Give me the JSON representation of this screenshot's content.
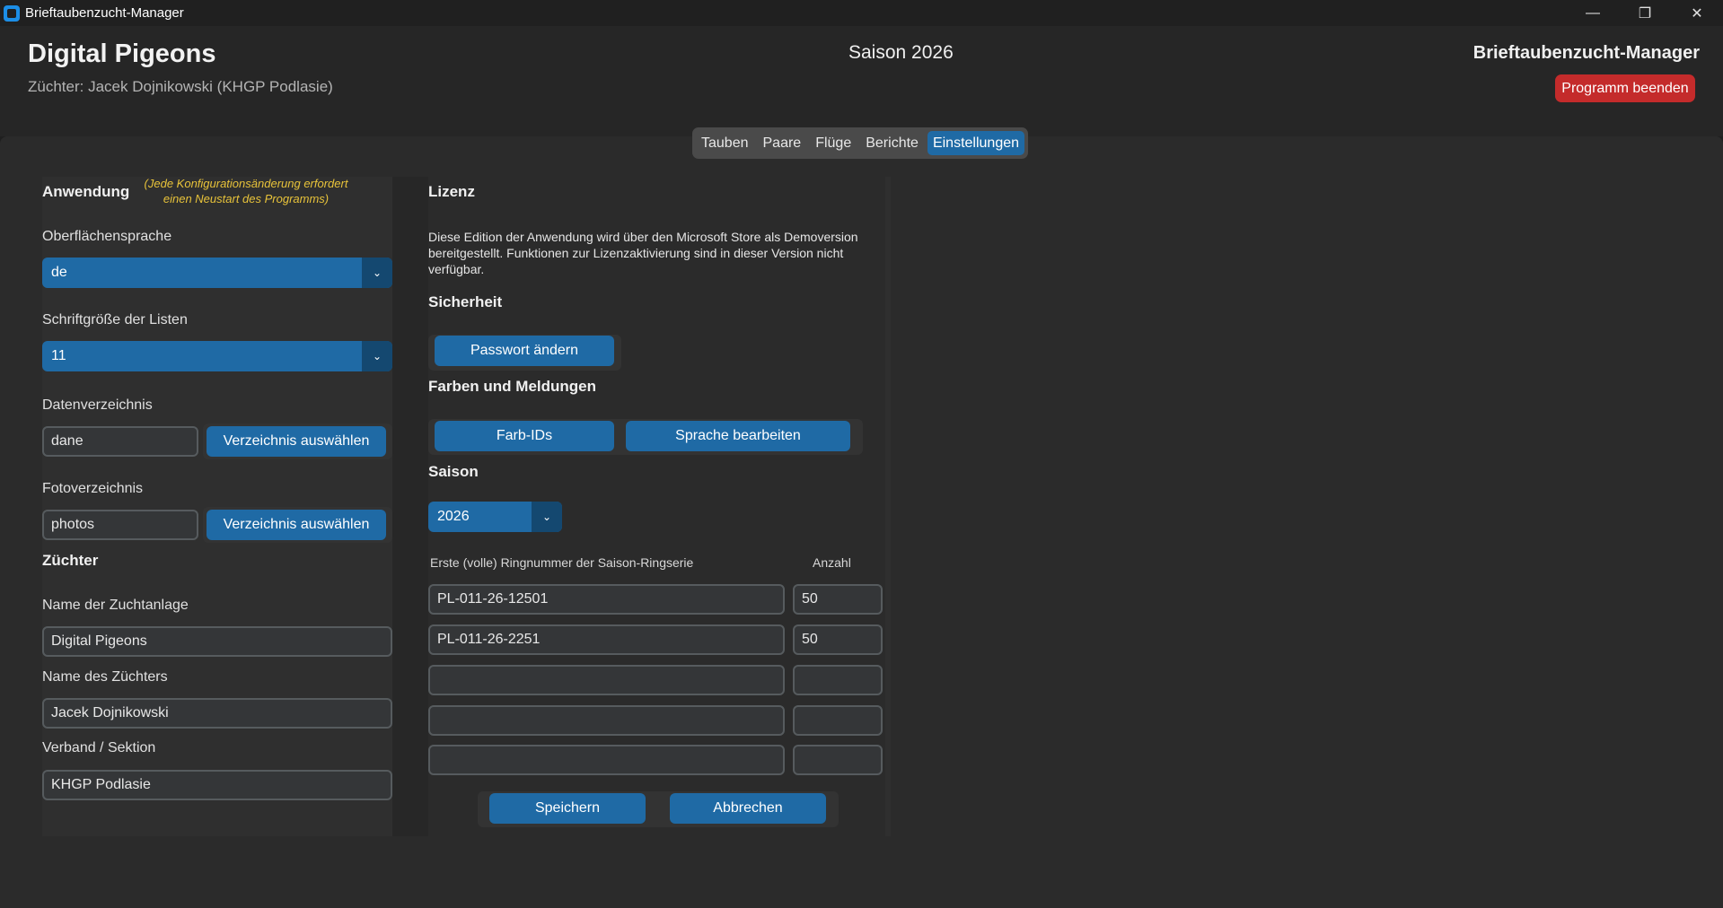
{
  "window": {
    "title": "Brieftaubenzucht-Manager",
    "controls": {
      "minimize": "—",
      "maximize": "❐",
      "close": "✕"
    }
  },
  "header": {
    "brand": "Digital Pigeons",
    "breeder": "Züchter: Jacek Dojnikowski (KHGP Podlasie)",
    "season": "Saison 2026",
    "app_name": "Brieftaubenzucht-Manager",
    "quit_label": "Programm beenden"
  },
  "tabs": [
    {
      "label": "Tauben"
    },
    {
      "label": "Paare"
    },
    {
      "label": "Flüge"
    },
    {
      "label": "Berichte"
    },
    {
      "label": "Einstellungen"
    }
  ],
  "application": {
    "title": "Anwendung",
    "hint_line1": "(Jede Konfigurationsänderung erfordert",
    "hint_line2": "einen Neustart des Programms)",
    "language_label": "Oberflächensprache",
    "language_value": "de",
    "fontsize_label": "Schriftgröße der Listen",
    "fontsize_value": "11",
    "datadir_label": "Datenverzeichnis",
    "datadir_value": "dane",
    "datadir_button": "Verzeichnis auswählen",
    "photodir_label": "Fotoverzeichnis",
    "photodir_value": "photos",
    "photodir_button": "Verzeichnis auswählen"
  },
  "breeder": {
    "title": "Züchter",
    "loft_label": "Name der Zuchtanlage",
    "loft_value": "Digital Pigeons",
    "name_label": "Name des Züchters",
    "name_value": "Jacek Dojnikowski",
    "club_label": "Verband / Sektion",
    "club_value": "KHGP Podlasie"
  },
  "license": {
    "title": "Lizenz",
    "line1": "Diese Edition der Anwendung wird über den Microsoft Store als Demoversion",
    "line2": "bereitgestellt. Funktionen zur Lizenzaktivierung sind in dieser Version nicht",
    "line3": "verfügbar."
  },
  "security": {
    "title": "Sicherheit",
    "change_password": "Passwort ändern"
  },
  "colors_messages": {
    "title": "Farben und Meldungen",
    "color_ids": "Farb-IDs",
    "edit_language": "Sprache bearbeiten"
  },
  "season": {
    "title": "Saison",
    "year_value": "2026",
    "ring_col_label": "Erste (volle) Ringnummer der Saison-Ringserie",
    "count_col_label": "Anzahl",
    "rows": [
      {
        "ring": "PL-011-26-12501",
        "count": "50"
      },
      {
        "ring": "PL-011-26-2251",
        "count": "50"
      },
      {
        "ring": "",
        "count": ""
      },
      {
        "ring": "",
        "count": ""
      },
      {
        "ring": "",
        "count": ""
      }
    ]
  },
  "actions": {
    "save": "Speichern",
    "cancel": "Abbrechen"
  },
  "icons": {
    "chevron": "⌄"
  },
  "colors": {
    "accent": "#1f6aa5",
    "danger": "#c42b2b",
    "hint": "#e8c33a"
  }
}
